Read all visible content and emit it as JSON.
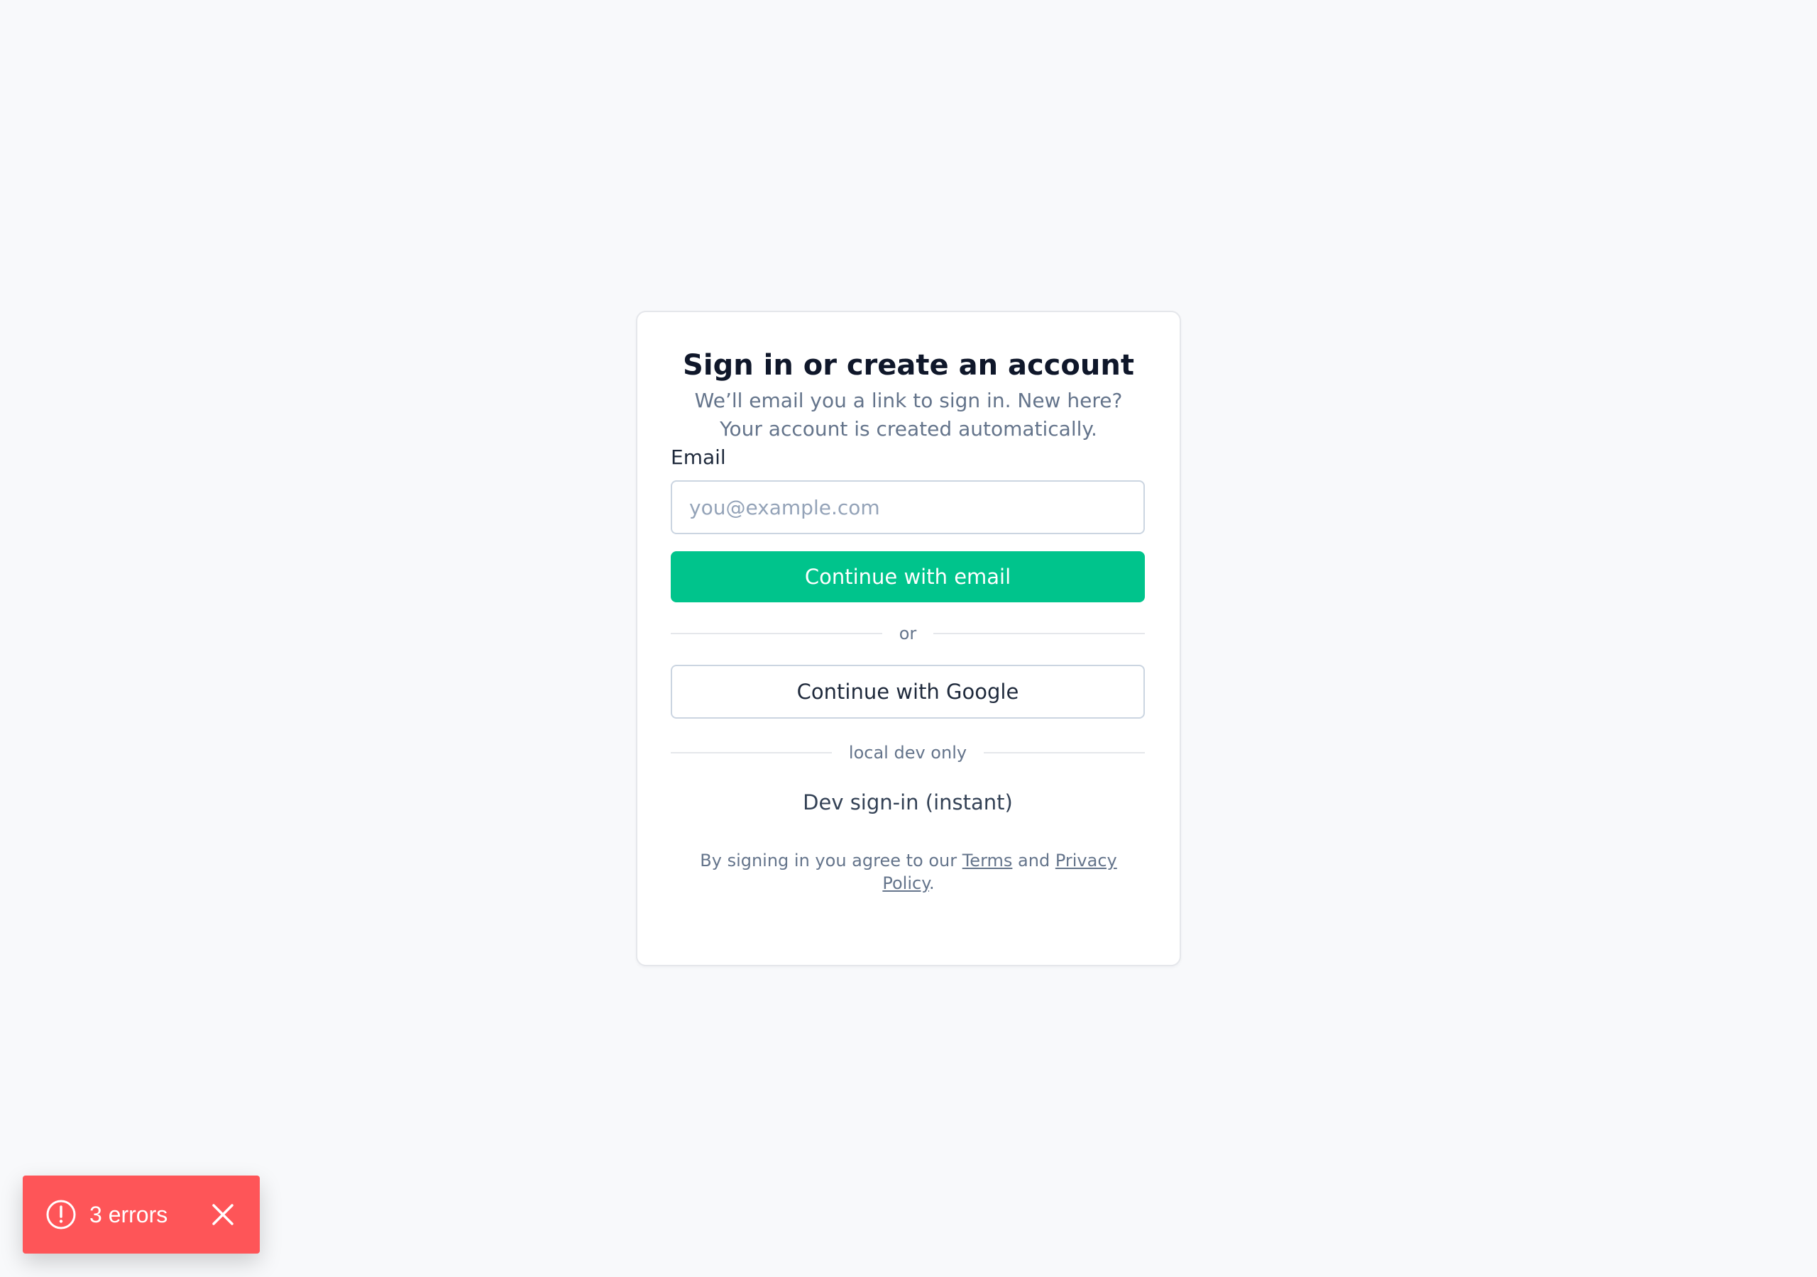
{
  "auth": {
    "title": "Sign in or create an account",
    "subtitle": "We’ll email you a link to sign in. New here? Your account is created automatically.",
    "email_label": "Email",
    "email_placeholder": "you@example.com",
    "email_value": "",
    "continue_email_label": "Continue with email",
    "or_label": "or",
    "continue_google_label": "Continue with Google",
    "dev_divider_label": "local dev only",
    "dev_signin_label": "Dev sign-in (instant)",
    "legal_prefix": "By signing in you agree to our ",
    "terms_label": "Terms",
    "legal_and": " and ",
    "privacy_label": "Privacy Policy",
    "legal_suffix": "."
  },
  "toast": {
    "label": "3 errors",
    "icon": "alert-circle-icon",
    "close_icon": "close-icon"
  },
  "colors": {
    "background": "#f8f9fb",
    "primary": "#00c48c",
    "error_toast": "#fe5558"
  }
}
